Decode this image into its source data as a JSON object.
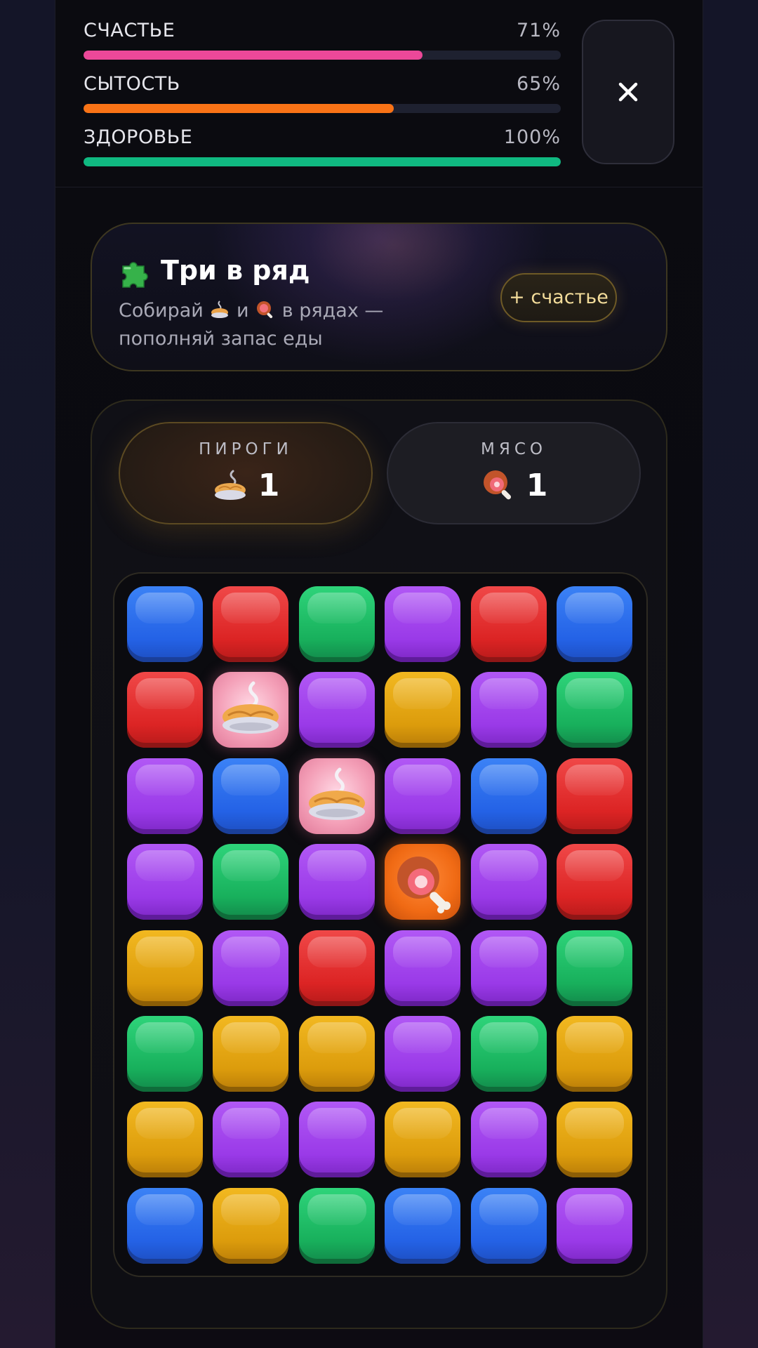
{
  "stats": [
    {
      "label": "СЧАСТЬЕ",
      "value": "71%",
      "percent": 71,
      "color": "#ec4899"
    },
    {
      "label": "СЫТОСТЬ",
      "value": "65%",
      "percent": 65,
      "color": "#f97316"
    },
    {
      "label": "ЗДОРОВЬЕ",
      "value": "100%",
      "percent": 100,
      "color": "#10b981"
    }
  ],
  "close_icon": "close-icon",
  "banner": {
    "icon": "puzzle-icon",
    "title": "Три в ряд",
    "desc_part1": "Собирай",
    "desc_and": "и",
    "desc_part2": "в рядах — пополняй запас еды",
    "bonus_label": "+ счастье"
  },
  "counters": {
    "pies": {
      "label": "ПИРОГИ",
      "value": "1",
      "icon": "pie-icon"
    },
    "meat": {
      "label": "МЯСО",
      "value": "1",
      "icon": "meat-icon"
    }
  },
  "board": {
    "cols": 6,
    "rows": 8,
    "tiles": [
      [
        "blue",
        "red",
        "green",
        "purple",
        "red",
        "blue"
      ],
      [
        "red",
        "pie",
        "purple",
        "yellow",
        "purple",
        "green"
      ],
      [
        "purple",
        "blue",
        "pie",
        "purple",
        "blue",
        "red"
      ],
      [
        "purple",
        "green",
        "purple",
        "meat",
        "purple",
        "red"
      ],
      [
        "yellow",
        "purple",
        "red",
        "purple",
        "purple",
        "green"
      ],
      [
        "green",
        "yellow",
        "yellow",
        "purple",
        "green",
        "yellow"
      ],
      [
        "yellow",
        "purple",
        "purple",
        "yellow",
        "purple",
        "yellow"
      ],
      [
        "blue",
        "yellow",
        "green",
        "blue",
        "blue",
        "purple"
      ]
    ]
  }
}
